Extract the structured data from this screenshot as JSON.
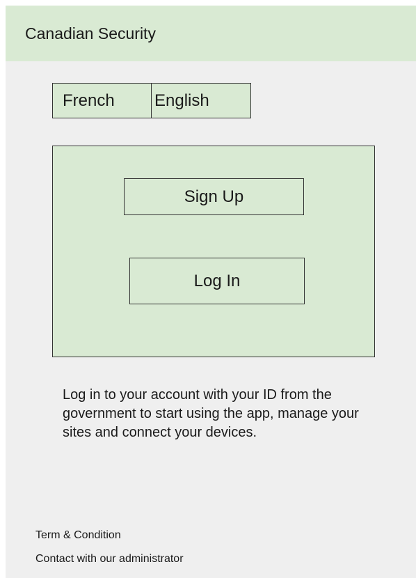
{
  "header": {
    "title": "Canadian Security"
  },
  "language": {
    "options": [
      "French",
      "English"
    ]
  },
  "auth": {
    "signup_label": "Sign Up",
    "login_label": "Log In"
  },
  "description": "Log in to your account with your ID from the government to start using the app, manage your sites and connect your devices.",
  "footer": {
    "terms": "Term & Condition",
    "contact": "Contact with our administrator"
  },
  "colors": {
    "panel_green": "#d9ead3",
    "screen_background": "#efefef",
    "border": "#333333"
  }
}
